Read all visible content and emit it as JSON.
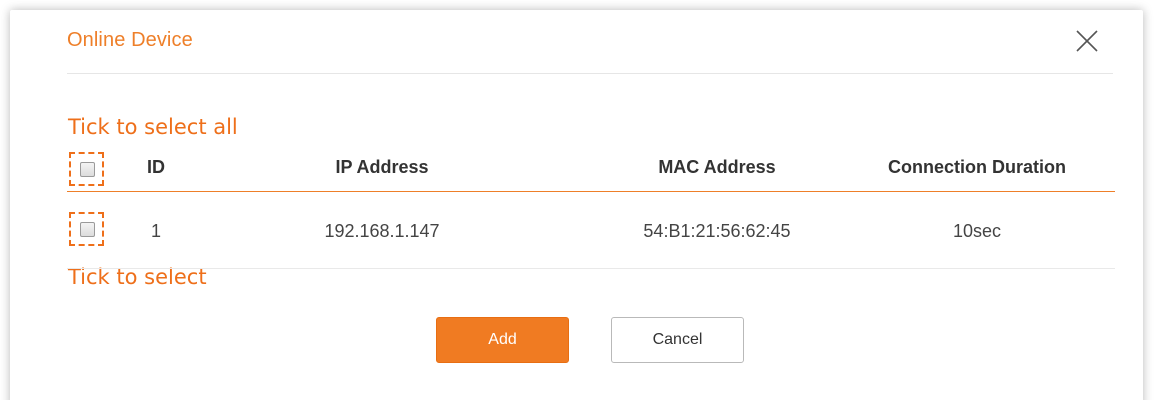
{
  "dialog": {
    "title": "Online Device",
    "close_icon": "close-icon"
  },
  "annotations": {
    "select_all": "Tick to select all",
    "select_one": "Tick to select"
  },
  "table": {
    "headers": {
      "id": "ID",
      "ip": "IP Address",
      "mac": "MAC Address",
      "duration": "Connection Duration"
    },
    "rows": [
      {
        "id": "1",
        "ip": "192.168.1.147",
        "mac": "54:B1:21:56:62:45",
        "duration": "10sec"
      }
    ]
  },
  "buttons": {
    "add": "Add",
    "cancel": "Cancel"
  },
  "colors": {
    "accent": "#ee7f29",
    "annotation": "#ee6f1a",
    "add_button": "#f07b22"
  }
}
